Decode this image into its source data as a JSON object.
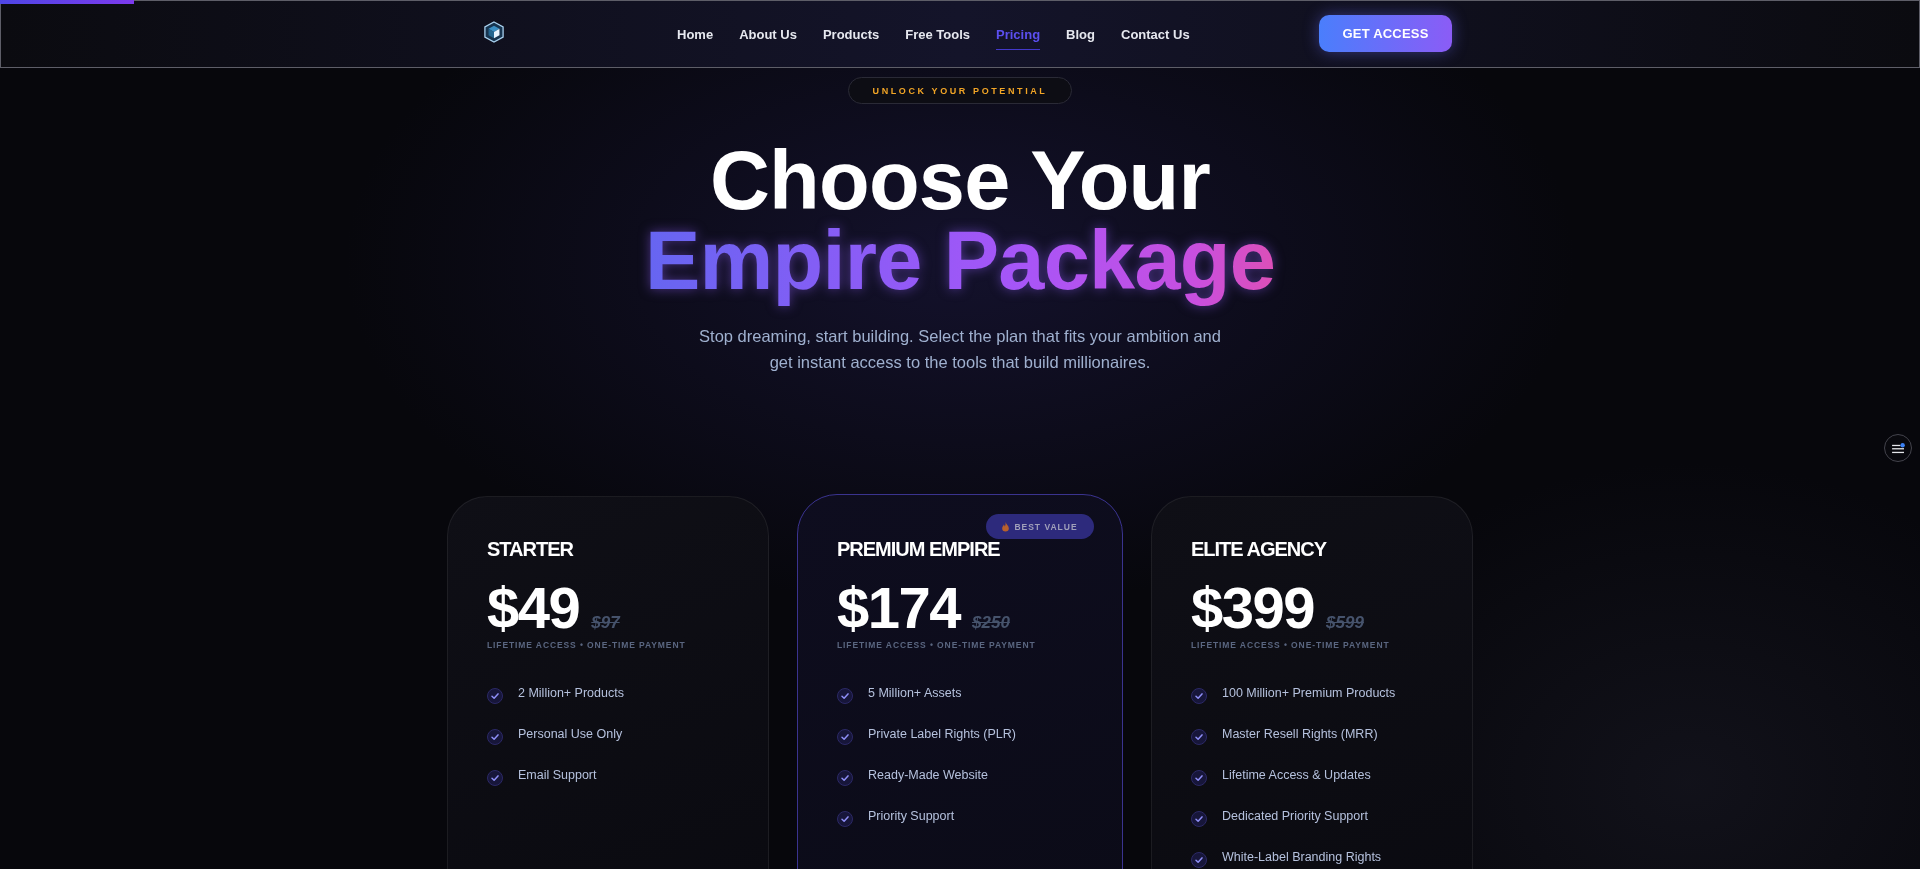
{
  "scroll_progress": {
    "level": 0.07
  },
  "nav": {
    "links": [
      {
        "label": "Home",
        "selected": false
      },
      {
        "label": "About Us",
        "selected": false
      },
      {
        "label": "Products",
        "selected": false
      },
      {
        "label": "Free Tools",
        "selected": false
      },
      {
        "label": "Pricing",
        "selected": true
      },
      {
        "label": "Blog",
        "selected": false
      },
      {
        "label": "Contact Us",
        "selected": false
      }
    ],
    "cta": "GET ACCESS"
  },
  "hero": {
    "tagline": "UNLOCK YOUR POTENTIAL",
    "title": "Choose Your",
    "title_highlight": "Empire Package",
    "subtitle": "Stop dreaming, start building. Select the plan that fits your ambition and get instant access to the tools that build millionaires."
  },
  "plans": [
    {
      "name": "STARTER",
      "price": "$49",
      "old_price": "$97",
      "terms": "LIFETIME ACCESS • ONE-TIME PAYMENT",
      "featured": false,
      "features": [
        "2 Million+ Products",
        "Personal Use Only",
        "Email Support"
      ]
    },
    {
      "name": "PREMIUM EMPIRE",
      "badge": "BEST VALUE",
      "price": "$174",
      "old_price": "$250",
      "terms": "LIFETIME ACCESS • ONE-TIME PAYMENT",
      "featured": true,
      "features": [
        "5 Million+ Assets",
        "Private Label Rights (PLR)",
        "Ready-Made Website",
        "Priority Support"
      ]
    },
    {
      "name": "ELITE AGENCY",
      "price": "$399",
      "old_price": "$599",
      "terms": "LIFETIME ACCESS • ONE-TIME PAYMENT",
      "featured": false,
      "features": [
        "100 Million+ Premium Products",
        "Master Resell Rights (MRR)",
        "Lifetime Access & Updates",
        "Dedicated Priority Support",
        "White-Label Branding Rights"
      ]
    }
  ]
}
